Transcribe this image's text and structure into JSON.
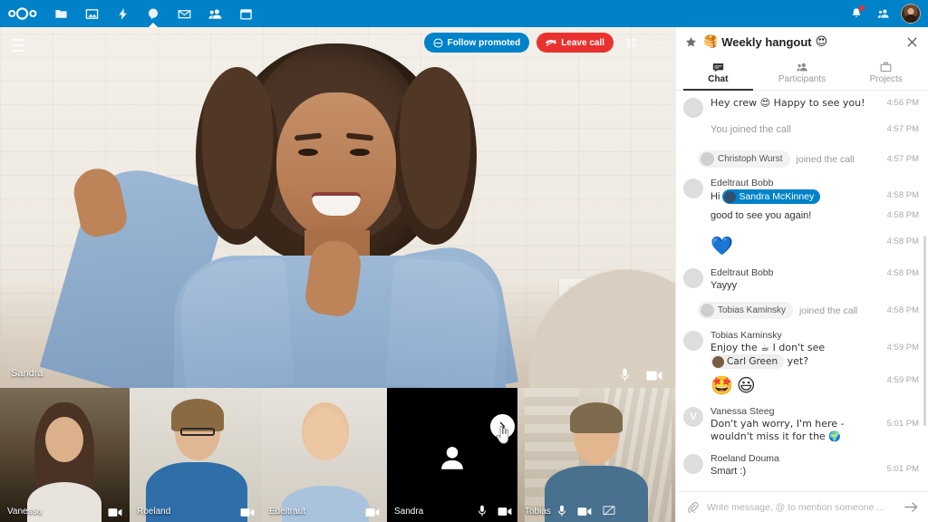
{
  "topnav": {
    "logo": "nextcloud-logo",
    "apps": [
      {
        "name": "files-icon",
        "label": "Files"
      },
      {
        "name": "photos-icon",
        "label": "Photos"
      },
      {
        "name": "activity-icon",
        "label": "Activity"
      },
      {
        "name": "talk-icon",
        "label": "Talk",
        "active": true
      },
      {
        "name": "mail-icon",
        "label": "Mail"
      },
      {
        "name": "contacts-icon",
        "label": "Contacts"
      },
      {
        "name": "calendar-icon",
        "label": "Calendar"
      }
    ],
    "right": [
      {
        "name": "notifications-bell-icon",
        "badge": true
      },
      {
        "name": "contacts-menu-icon"
      },
      {
        "name": "user-avatar"
      }
    ]
  },
  "call": {
    "menu_icon": "hamburger-menu-icon",
    "follow_promoted_label": "Follow promoted",
    "follow_promoted_icon": "promoted-icon",
    "leave_call_label": "Leave call",
    "leave_call_icon": "leave-call-icon",
    "grid_view_icon": "grid-view-icon",
    "more_options_icon": "more-options-icon",
    "promoted": {
      "name": "Sandra",
      "mic_icon": "microphone-icon",
      "camera_icon": "camera-icon"
    },
    "next_button_icon": "chevron-right-icon",
    "cursor_icon": "hand-cursor-icon",
    "participants": [
      {
        "name": "Vanessa",
        "icons": [
          "camera-icon"
        ]
      },
      {
        "name": "Roeland",
        "icons": [
          "camera-icon"
        ]
      },
      {
        "name": "Edeltraut",
        "icons": [
          "camera-icon"
        ]
      },
      {
        "name": "Sandra",
        "icons": [
          "microphone-icon",
          "camera-icon"
        ],
        "no_video": true
      },
      {
        "name": "Tobias",
        "icons": [
          "microphone-icon",
          "camera-icon",
          "screenshare-off-icon"
        ]
      }
    ]
  },
  "sidebar": {
    "favorite_icon": "star-icon",
    "room_emoji": "🥞",
    "title": "Weekly hangout",
    "title_emoji": "😍",
    "close_icon": "close-icon",
    "tabs": [
      {
        "label": "Chat",
        "icon": "chat-icon",
        "active": true
      },
      {
        "label": "Participants",
        "icon": "participants-icon",
        "active": false
      },
      {
        "label": "Projects",
        "icon": "projects-icon",
        "active": false
      }
    ],
    "messages": [
      {
        "type": "message",
        "author": null,
        "avatar": "photo-c",
        "text": "Hey crew 😍 Happy to see you!",
        "time": "4:56 PM"
      },
      {
        "type": "system_plain",
        "text": "You joined the call",
        "time": "4:57 PM"
      },
      {
        "type": "system_chip",
        "chip_name": "Christoph Wurst",
        "text": "joined the call",
        "time": "4:57 PM"
      },
      {
        "type": "message_mention",
        "author": "Edeltraut Bobb",
        "avatar": "photo-a",
        "prefix": "Hi ",
        "mention": "Sandra McKinney",
        "suffix": "",
        "time": "4:58 PM"
      },
      {
        "type": "message",
        "author": null,
        "avatar": "blank",
        "text": "good to see you again!",
        "time": "4:58 PM"
      },
      {
        "type": "emoji",
        "author": null,
        "avatar": "blank",
        "text": "💙",
        "time": "4:58 PM"
      },
      {
        "type": "message",
        "author": "Edeltraut Bobb",
        "avatar": "photo-a",
        "text": "Yayyy",
        "time": "4:58 PM"
      },
      {
        "type": "system_chip",
        "chip_name": "Tobias Kaminsky",
        "text": "joined the call",
        "time": "4:58 PM"
      },
      {
        "type": "message_mention_grey",
        "author": "Tobias Kaminsky",
        "avatar": "photo-d",
        "prefix": "Enjoy the ☕ I don't see ",
        "mention": "Carl Green",
        "suffix": " yet?",
        "time": "4:59 PM"
      },
      {
        "type": "emoji_pair",
        "author": null,
        "avatar": "blank",
        "text": "🤩😃",
        "time": "4:59 PM"
      },
      {
        "type": "message",
        "author": "Vanessa Steeg",
        "avatar": "purple",
        "avatar_letter": "V",
        "text": "Don't yah worry, I'm here - wouldn't miss it for the 🌍",
        "time": "5:01 PM"
      },
      {
        "type": "message",
        "author": "Roeland Douma",
        "avatar": "photo-c",
        "text": "Smart :)",
        "time": "5:01 PM"
      }
    ],
    "composer": {
      "attach_icon": "paperclip-icon",
      "placeholder": "Write message, @ to mention someone ...",
      "send_icon": "send-arrow-icon"
    }
  },
  "colors": {
    "brand_blue": "#0082c9",
    "danger_red": "#e9322d",
    "mention_blue": "#0082c9",
    "avatar_purple": "#9b4fc8"
  }
}
